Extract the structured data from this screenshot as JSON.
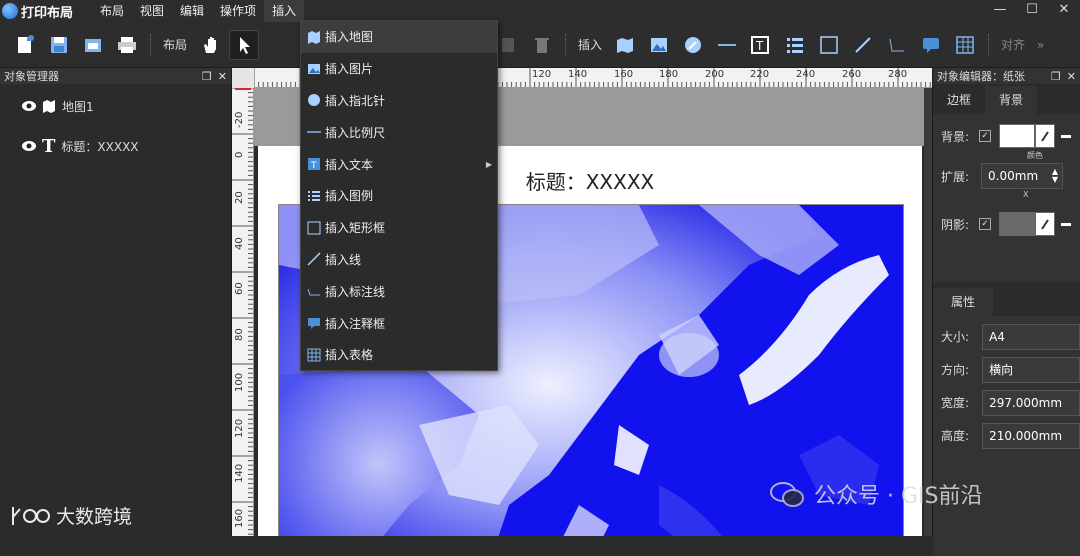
{
  "menubar": {
    "app_title": "打印布局",
    "items": [
      "布局",
      "视图",
      "编辑",
      "操作项",
      "插入"
    ],
    "window_controls": [
      "minimize-icon",
      "maximize-icon",
      "close-icon"
    ]
  },
  "toolbar": {
    "layout_label": "布局",
    "insert_label": "插入",
    "align_label": "对齐"
  },
  "object_manager": {
    "title": "对象管理器",
    "items": [
      {
        "label": "地图1",
        "icon": "map-icon"
      },
      {
        "label": "标题：XXXXX",
        "icon": "text-icon"
      }
    ]
  },
  "canvas": {
    "page_title": "标题：XXXXX",
    "ruler_top_ticks": [
      "120",
      "140",
      "160",
      "180",
      "200",
      "220",
      "240",
      "260",
      "280"
    ],
    "ruler_left_ticks": [
      "-20",
      "0",
      "20",
      "40",
      "60",
      "80",
      "100",
      "120",
      "140",
      "160"
    ]
  },
  "insert_menu": {
    "items": [
      {
        "label": "插入地图",
        "icon": "map-icon"
      },
      {
        "label": "插入图片",
        "icon": "image-icon"
      },
      {
        "label": "插入指北针",
        "icon": "compass-icon"
      },
      {
        "label": "插入比例尺",
        "icon": "scalebar-icon"
      },
      {
        "label": "插入文本",
        "icon": "text-icon"
      },
      {
        "label": "插入图例",
        "icon": "legend-icon"
      },
      {
        "label": "插入矩形框",
        "icon": "rectangle-icon"
      },
      {
        "label": "插入线",
        "icon": "line-icon"
      },
      {
        "label": "插入标注线",
        "icon": "callout-line-icon"
      },
      {
        "label": "插入注释框",
        "icon": "comment-icon"
      },
      {
        "label": "插入表格",
        "icon": "table-icon"
      }
    ]
  },
  "object_editor": {
    "title": "对象编辑器：纸张",
    "tabs": [
      "边框",
      "背景"
    ],
    "background_label": "背景:",
    "color_caption": "颜色",
    "expand_label": "扩展:",
    "expand_value": "0.00mm",
    "expand_caption": "X",
    "shadow_label": "阴影:",
    "properties_tab": "属性",
    "props": [
      {
        "label": "大小:",
        "value": "A4"
      },
      {
        "label": "方向:",
        "value": "横向"
      },
      {
        "label": "宽度:",
        "value": "297.000mm"
      },
      {
        "label": "高度:",
        "value": "210.000mm"
      }
    ]
  },
  "watermarks": {
    "left": "大数跨境",
    "right": "公众号 · GIS前沿"
  }
}
